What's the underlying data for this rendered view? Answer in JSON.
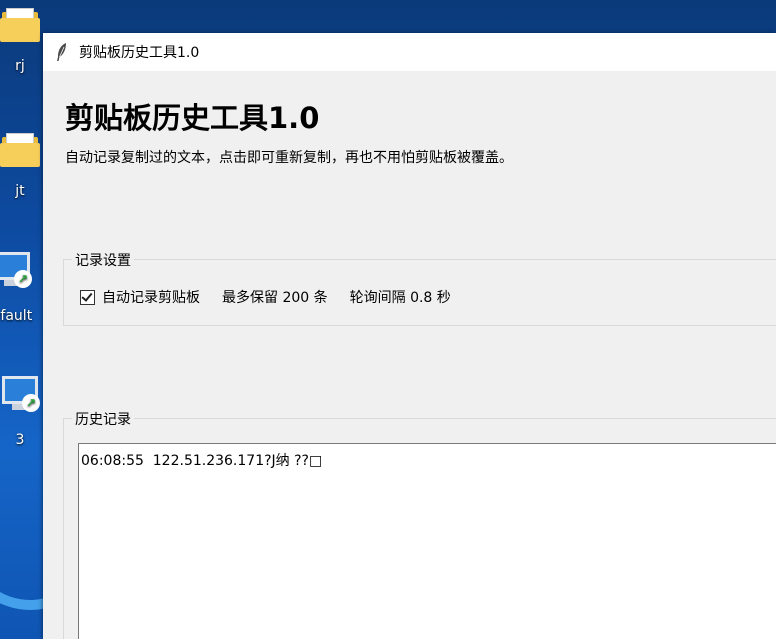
{
  "desktop": {
    "icons": [
      {
        "label": "rj",
        "type": "folder"
      },
      {
        "label": "jt",
        "type": "folder"
      },
      {
        "label": "efault",
        "type": "remote-desktop"
      },
      {
        "label": "3",
        "type": "remote-desktop"
      }
    ],
    "background_color": "#0d4aa0"
  },
  "window": {
    "title": "剪贴板历史工具1.0",
    "icon": "feather-icon"
  },
  "header": {
    "title": "剪贴板历史工具1.0",
    "subtitle": "自动记录复制过的文本，点击即可重新复制，再也不用怕剪贴板被覆盖。"
  },
  "settings": {
    "group_label": "记录设置",
    "auto_record_label": "自动记录剪贴板",
    "auto_record_checked": true,
    "max_keep_text": "最多保留 200 条",
    "poll_interval_text": "轮询间隔 0.8 秒"
  },
  "history": {
    "group_label": "历史记录",
    "items": [
      "06:08:55  122.51.236.171?J纳 ??□"
    ]
  }
}
